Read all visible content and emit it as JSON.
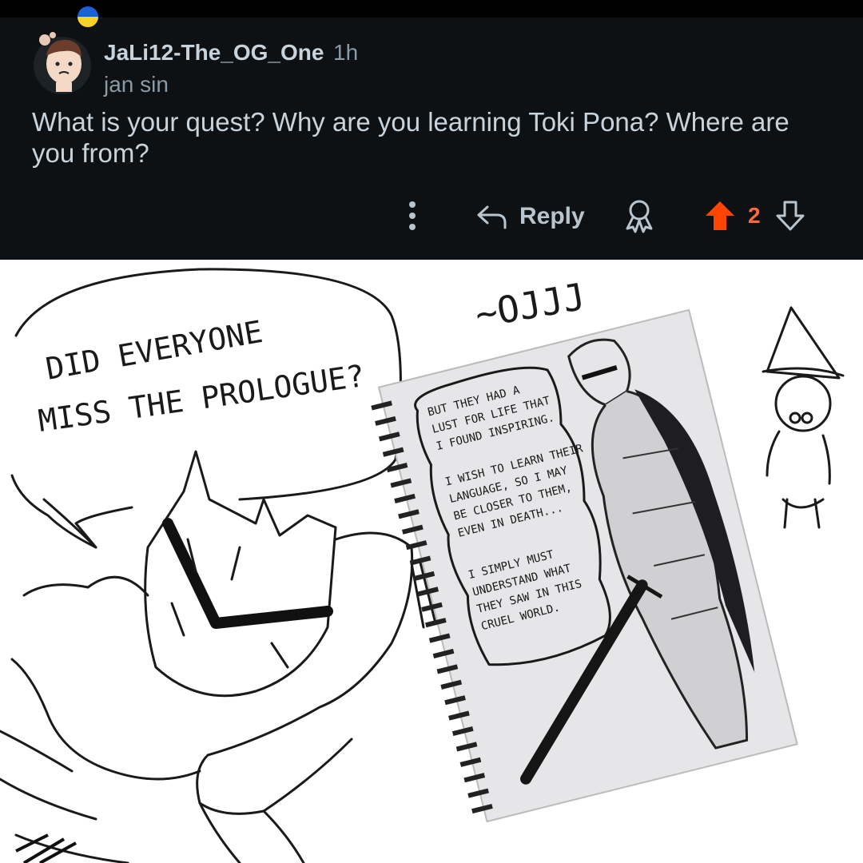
{
  "comment": {
    "username": "JaLi12-The_OG_One",
    "time": "1h",
    "flair": "jan sin",
    "body": "What is your quest? Why are you learning Toki Pona? Where are you from?",
    "reply_label": "Reply",
    "vote_count": "2"
  },
  "icons": {
    "flag": "ukraine-flag-icon",
    "more": "more-vertical-icon",
    "reply": "reply-arrow-icon",
    "award": "award-icon",
    "upvote": "upvote-arrow-icon",
    "downvote": "downvote-arrow-icon"
  },
  "colors": {
    "background": "#0e1113",
    "text": "#c8d3dc",
    "muted": "#8a9aa6",
    "upvote": "#ff4500"
  },
  "comic": {
    "speech_line_1": "DID EVERYONE",
    "speech_line_2": "MISS THE PROLOGUE?",
    "sound_effect": "~OJJJ",
    "notebook_lines": [
      "BUT THEY HAD A",
      "LUST FOR LIFE THAT",
      "I FOUND INSPIRING.",
      "I WISH TO LEARN THEIR",
      "LANGUAGE, SO I MAY",
      "BE CLOSER TO THEM,",
      "EVEN IN DEATH...",
      "I SIMPLY MUST",
      "UNDERSTAND WHAT",
      "THEY SAW IN THIS",
      "CRUEL WORLD."
    ]
  }
}
